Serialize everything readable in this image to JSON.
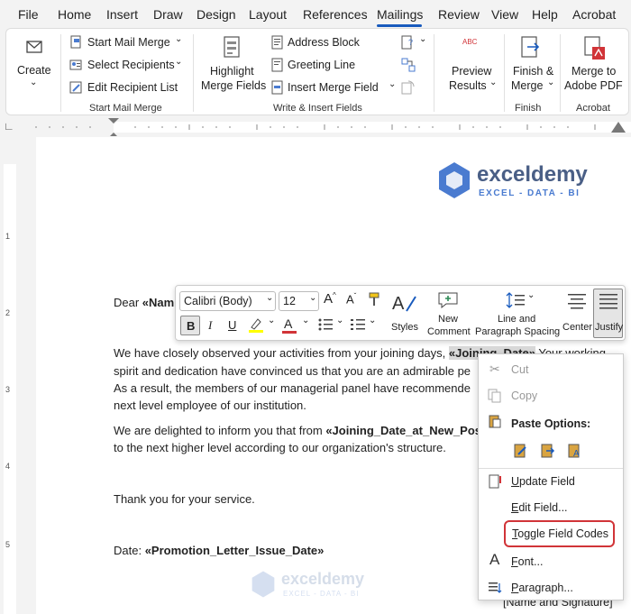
{
  "tabs": [
    "File",
    "Home",
    "Insert",
    "Draw",
    "Design",
    "Layout",
    "References",
    "Mailings",
    "Review",
    "View",
    "Help",
    "Acrobat"
  ],
  "ribbon": {
    "create": "Create",
    "start_mail_merge": "Start Mail Merge",
    "select_recipients": "Select Recipients",
    "edit_recipient_list": "Edit Recipient List",
    "group_start": "Start Mail Merge",
    "highlight": "Highlight",
    "merge_fields": "Merge Fields",
    "address_block": "Address Block",
    "greeting_line": "Greeting Line",
    "insert_merge_field": "Insert Merge Field",
    "group_write": "Write & Insert Fields",
    "preview_abc": "ABC",
    "preview": "Preview",
    "results": "Results",
    "finish_line1": "Finish &",
    "finish_line2": "Merge",
    "group_finish": "Finish",
    "merge_pdf_line1": "Merge to",
    "merge_pdf_line2": "Adobe PDF",
    "group_acrobat": "Acrobat"
  },
  "watermark": {
    "name": "exceldemy",
    "tagline": "EXCEL - DATA - BI"
  },
  "doc": {
    "dear": "Dear ",
    "dear_field": "«Nam",
    "p1a": "We have closely observed your activities from your joining days, ",
    "p1_field": "«Joining_Date»",
    "p1_after": " Your working",
    "p1b": "spirit and dedication have convinced us that you are an admirable pe",
    "p1c": "As a result, the members of our managerial panel have recommende",
    "p1d": "next level employee of our institution.",
    "p2a": "We are delighted to inform you that from ",
    "p2_field": "«Joining_Date_at_New_Posit",
    "p2b": "to the next higher level according to our organization's structure.",
    "thanks": "Thank you for your service.",
    "date_label": "Date: ",
    "date_field": "«Promotion_Letter_Issue_Date»",
    "signature": "[Name and Signature]"
  },
  "mini_toolbar": {
    "font": "Calibri (Body)",
    "size": "12",
    "bold": "B",
    "italic": "I",
    "underline": "U",
    "styles": "Styles",
    "new_comment_1": "New",
    "new_comment_2": "Comment",
    "line_spacing_1": "Line and",
    "line_spacing_2": "Paragraph Spacing",
    "center": "Center",
    "justify": "Justify"
  },
  "context_menu": {
    "cut": "Cut",
    "copy": "Copy",
    "paste_options": "Paste Options:",
    "update_field": "Update Field",
    "edit_field": "Edit Field...",
    "toggle_field_codes": "Toggle Field Codes",
    "font": "Font...",
    "paragraph": "Paragraph..."
  },
  "ruler": {
    "marks": [
      "1",
      "2",
      "3",
      "4",
      "5"
    ]
  },
  "colors": {
    "accent": "#185abd",
    "highlight_red": "#d13438",
    "field_shade": "#d9d9d9"
  }
}
